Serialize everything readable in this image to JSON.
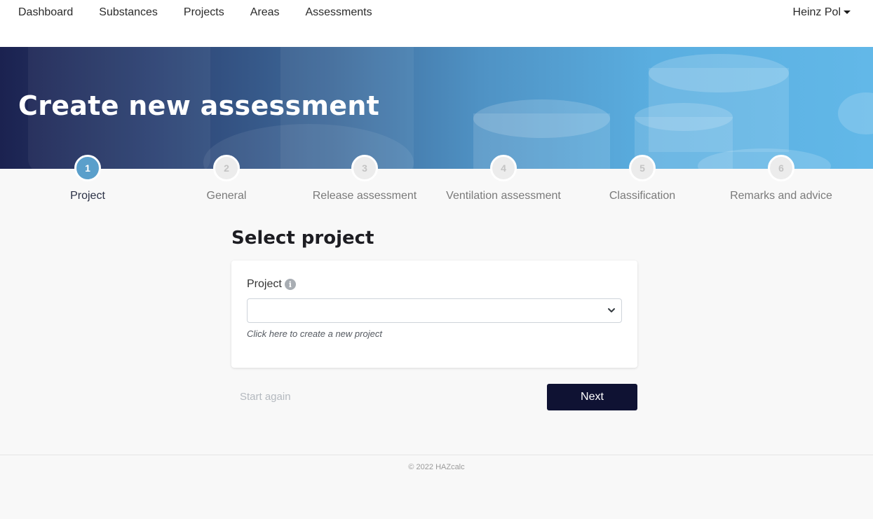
{
  "nav": {
    "links": [
      "Dashboard",
      "Substances",
      "Projects",
      "Areas",
      "Assessments"
    ],
    "user": "Heinz Pol"
  },
  "banner": {
    "title": "Create new assessment"
  },
  "stepper": {
    "active_step": 1,
    "steps": [
      {
        "number": "1",
        "label": "Project"
      },
      {
        "number": "2",
        "label": "General"
      },
      {
        "number": "3",
        "label": "Release assessment"
      },
      {
        "number": "4",
        "label": "Ventilation assessment"
      },
      {
        "number": "5",
        "label": "Classification"
      },
      {
        "number": "6",
        "label": "Remarks and advice"
      }
    ]
  },
  "main": {
    "section_title": "Select project",
    "project_field": {
      "label": "Project",
      "info_icon": "i",
      "value": "",
      "helper_link": "Click here to create a new project"
    },
    "start_again_label": "Start again",
    "next_label": "Next"
  },
  "footer": {
    "text": "© 2022 HAZcalc"
  },
  "colors": {
    "accent": "#5a9fcb",
    "primary_button": "#0f1233",
    "banner_dark": "#1b2250",
    "banner_light": "#62b8e8"
  }
}
